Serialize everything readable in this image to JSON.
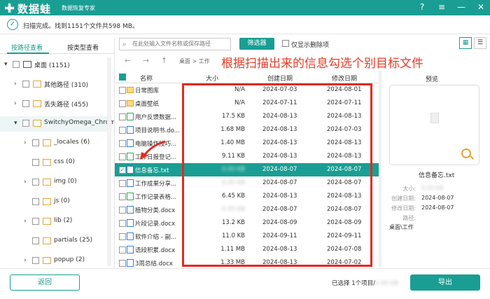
{
  "app": {
    "name": "数据蛙",
    "subtitle": "数据恢复专家"
  },
  "window_buttons": [
    "?",
    "≡",
    "—",
    "✕"
  ],
  "status": {
    "text": "扫描完成。找到1151个文件共598 MB。"
  },
  "left_tabs": {
    "by_path": "按路径查看",
    "by_type": "按类型查看"
  },
  "tree": [
    {
      "arrow": "▾",
      "label": "桌面 (1151)"
    },
    {
      "arrow": "›",
      "label": "其他路径 (310)"
    },
    {
      "arrow": "›",
      "label": "丢失路径 (455)"
    },
    {
      "arrow": "▾",
      "label": "SwitchyOmega_Chrom"
    },
    {
      "arrow": "›",
      "label": "_locales (6)"
    },
    {
      "arrow": "",
      "label": "css (0)"
    },
    {
      "arrow": "›",
      "label": "img (0)"
    },
    {
      "arrow": "",
      "label": "js (0)"
    },
    {
      "arrow": "›",
      "label": "lib (2)"
    },
    {
      "arrow": "",
      "label": "partials (25)"
    },
    {
      "arrow": "›",
      "label": "popup (2)"
    }
  ],
  "toolbar": {
    "search_placeholder": "在此处输入文件名称或保存路径",
    "filter_label": "筛选器",
    "deleted_only_label": "仅显示删除项"
  },
  "nav": {
    "back": "←",
    "forward": "→",
    "up": "↑",
    "path": "桌面 > 工作"
  },
  "annotation": "根据扫描出来的信息勾选个别目标文件",
  "table": {
    "headers": {
      "name": "名称",
      "size": "大小",
      "created": "创建日期",
      "modified": "修改日期"
    },
    "rows": [
      {
        "name": "日常图库",
        "size": "N/A",
        "created": "2024-07-03",
        "modified": "2024-08-01",
        "icon": "folder",
        "checked": false,
        "selected": false
      },
      {
        "name": "桌面壁纸",
        "size": "N/A",
        "created": "2024-07-11",
        "modified": "2024-07-11",
        "icon": "folder",
        "checked": false,
        "selected": false
      },
      {
        "name": "用户反馈数据...",
        "size": "17.5 KB",
        "created": "2024-08-13",
        "modified": "2024-08-13",
        "icon": "green",
        "checked": false,
        "selected": false
      },
      {
        "name": "项目说明书.do...",
        "size": "1.68 MB",
        "created": "2024-08-13",
        "modified": "2024-07-03",
        "icon": "doc",
        "checked": false,
        "selected": false
      },
      {
        "name": "电脑操作技巧...",
        "size": "1.40 MB",
        "created": "2024-08-13",
        "modified": "2024-08-13",
        "icon": "doc",
        "checked": false,
        "selected": false
      },
      {
        "name": "工作日报登记...",
        "size": "9.11 KB",
        "created": "2024-08-13",
        "modified": "2024-08-13",
        "icon": "green",
        "checked": false,
        "selected": false
      },
      {
        "name": "信息备忘.txt",
        "size": "",
        "created": "2024-08-07",
        "modified": "2024-08-07",
        "icon": "doc",
        "checked": true,
        "selected": true
      },
      {
        "name": "工作成果分享...",
        "size": "",
        "created": "2024-08-07",
        "modified": "2024-08-07",
        "icon": "doc",
        "checked": false,
        "selected": false
      },
      {
        "name": "工作记录表格...",
        "size": "6.45 KB",
        "created": "2024-08-13",
        "modified": "2024-08-13",
        "icon": "green",
        "checked": false,
        "selected": false
      },
      {
        "name": "植物分类.docx",
        "size": "",
        "created": "2024-08-07",
        "modified": "2024-08-07",
        "icon": "doc",
        "checked": false,
        "selected": false
      },
      {
        "name": "片段记录.docx",
        "size": "13.2 KB",
        "created": "2024-08-09",
        "modified": "2024-08-09",
        "icon": "doc",
        "checked": false,
        "selected": false
      },
      {
        "name": "软件介绍 - 副...",
        "size": "11.0 KB",
        "created": "2024-09-11",
        "modified": "2024-09-11",
        "icon": "doc",
        "checked": false,
        "selected": false
      },
      {
        "name": "语段积累.docx",
        "size": "1.11 MB",
        "created": "2024-08-13",
        "modified": "2024-07-08",
        "icon": "doc",
        "checked": false,
        "selected": false
      },
      {
        "name": "3周总结.docx",
        "size": "1.33 MB",
        "created": "2024-08-13",
        "modified": "2024-07-02",
        "icon": "doc",
        "checked": false,
        "selected": false
      }
    ]
  },
  "preview": {
    "title": "预览",
    "filename": "信息备忘.txt",
    "size_label": "大小:",
    "created_label": "创建日期:",
    "created": "2024-08-07",
    "modified_label": "修改日期:",
    "modified": "2024-08-07",
    "path_label": "路径:",
    "path": "桌面\\工作"
  },
  "footer": {
    "back_label": "返回",
    "selection": "已选择 1个项目/",
    "export_label": "导出"
  },
  "colors": {
    "accent": "#1a9e93",
    "annotation_red": "#e22b1f"
  }
}
